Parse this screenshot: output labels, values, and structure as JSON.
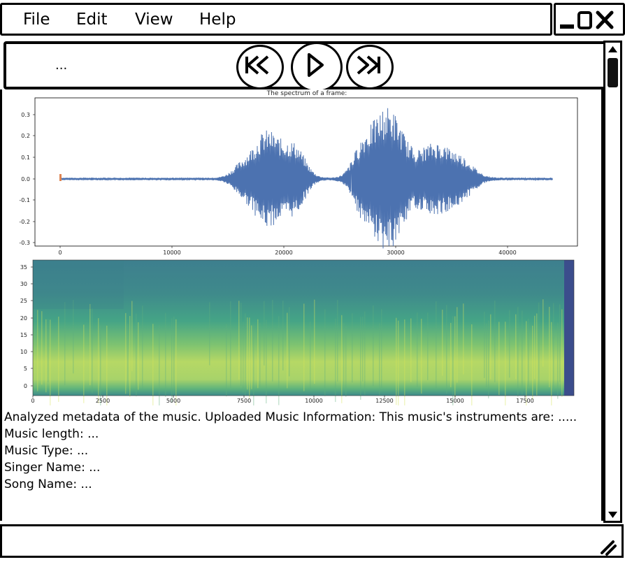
{
  "menu": {
    "file": "File",
    "edit": "Edit",
    "view": "View",
    "help": "Help"
  },
  "toolbar": {
    "track_text": "..."
  },
  "waveform": {
    "title": "The spectrum of a frame:",
    "ytick_labels": [
      "0.3",
      "0.2",
      "0.1",
      "0.0",
      "-0.1",
      "-0.2",
      "-0.3"
    ],
    "xtick_labels": [
      "0",
      "10000",
      "20000",
      "30000",
      "40000"
    ]
  },
  "spectrogram": {
    "ytick_labels": [
      "35",
      "30",
      "25",
      "20",
      "15",
      "10",
      "5",
      "0"
    ],
    "xtick_labels": [
      "0",
      "2500",
      "5000",
      "7500",
      "10000",
      "12500",
      "15000",
      "17500"
    ]
  },
  "info": {
    "summary": "Analyzed metadata of the music. Uploaded Music Information: This music's instruments are: .....",
    "length": "Music length: ...",
    "type": "Music Type: ...",
    "singer": "Singer Name: ...",
    "song": "Song Name: ..."
  },
  "colors": {
    "waveform_line": "#4c72b0",
    "spectrogram_dark": "#3b4d8c",
    "spectrogram_mid": "#3a9a8f",
    "spectrogram_bright": "#c9de5a"
  }
}
